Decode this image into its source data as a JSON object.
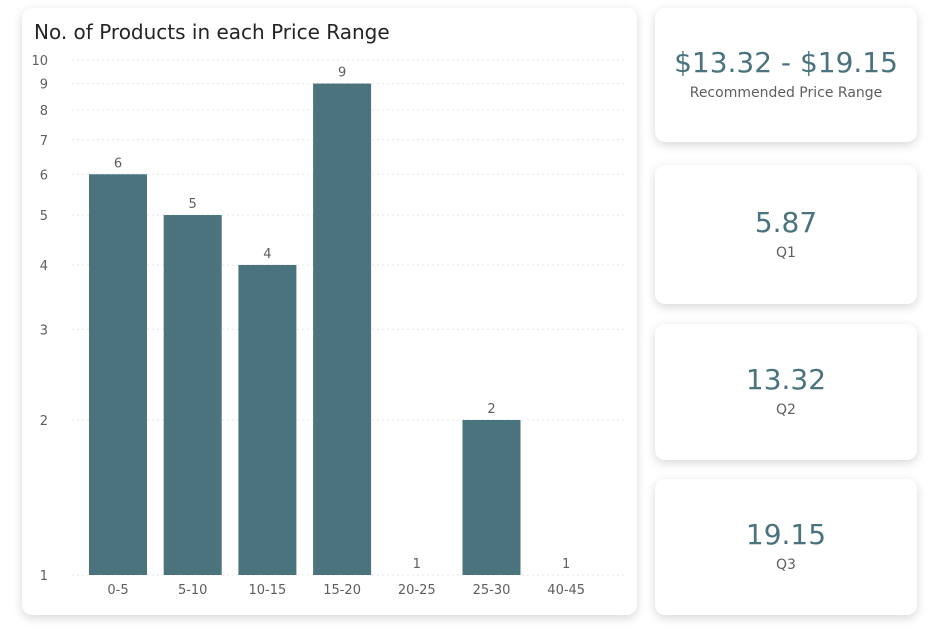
{
  "chart_data": {
    "type": "bar",
    "title": "No. of Products in each Price Range",
    "categories": [
      "0-5",
      "5-10",
      "10-15",
      "15-20",
      "20-25",
      "25-30",
      "40-45"
    ],
    "values": [
      6,
      5,
      4,
      9,
      1,
      2,
      1
    ],
    "yscale": "log",
    "ylim": [
      1,
      10
    ],
    "yticks": [
      1,
      2,
      3,
      4,
      5,
      6,
      7,
      8,
      9,
      10
    ],
    "grid": true,
    "bar_color": "#4a737d"
  },
  "kpis": {
    "range": {
      "value": "$13.32 - $19.15",
      "label": "Recommended Price Range"
    },
    "q1": {
      "value": "5.87",
      "label": "Q1"
    },
    "q2": {
      "value": "13.32",
      "label": "Q2"
    },
    "q3": {
      "value": "19.15",
      "label": "Q3"
    }
  }
}
